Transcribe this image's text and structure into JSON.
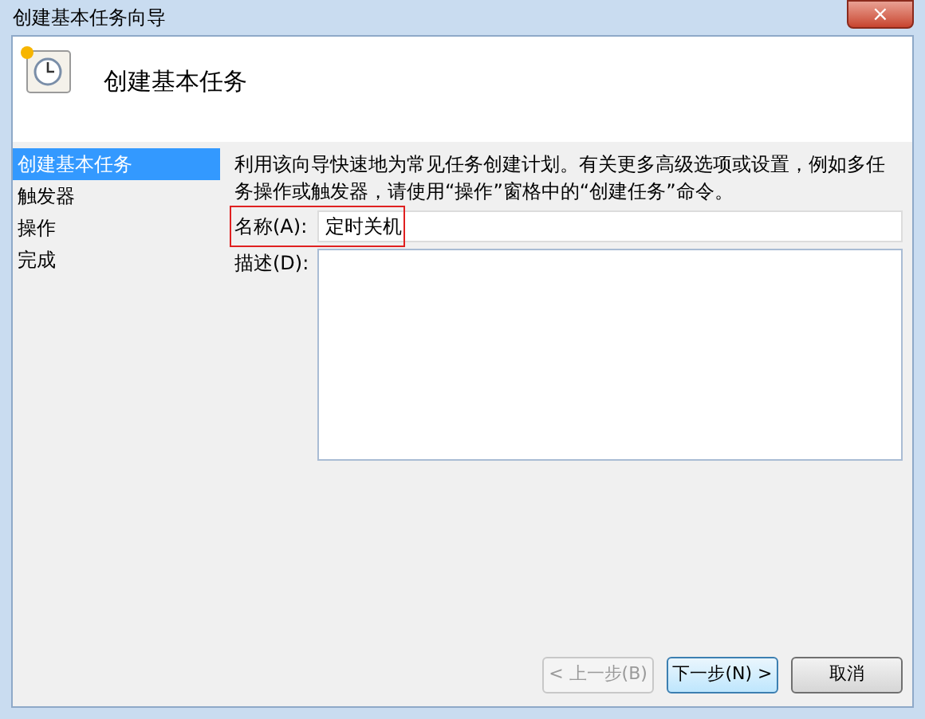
{
  "window": {
    "title": "创建基本任务向导",
    "close_button": "×"
  },
  "header": {
    "title": "创建基本任务"
  },
  "sidebar": {
    "items": [
      {
        "label": "创建基本任务",
        "selected": true
      },
      {
        "label": "触发器",
        "selected": false
      },
      {
        "label": "操作",
        "selected": false
      },
      {
        "label": "完成",
        "selected": false
      }
    ]
  },
  "intro": "利用该向导快速地为常见任务创建计划。有关更多高级选项或设置，例如多任务操作或触发器，请使用“操作”窗格中的“创建任务”命令。",
  "name_field": {
    "label": "名称(A):",
    "value": "定时关机",
    "highlighted": true
  },
  "description_field": {
    "label": "描述(D):"
  },
  "buttons": [
    {
      "label": "< 上一步(B)",
      "disabled": true,
      "focused": false
    },
    {
      "label": "下一步(N) >",
      "disabled": false,
      "focused": true
    },
    {
      "label": "取消",
      "disabled": false,
      "focused": false
    }
  ]
}
